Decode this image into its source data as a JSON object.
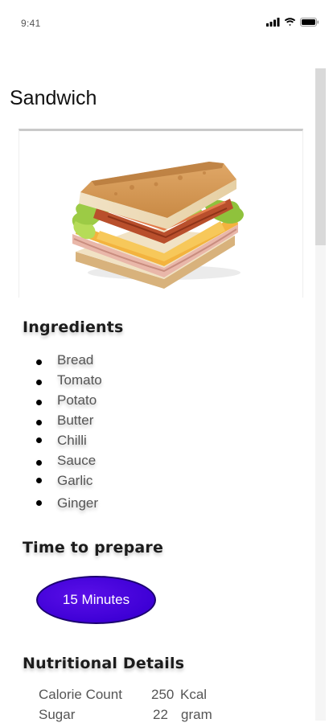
{
  "status_bar": {
    "time": "9:41"
  },
  "header": {
    "title": "Sandwich"
  },
  "ingredients": {
    "title": "Ingredients",
    "items": [
      "Bread",
      "Tomato",
      "Potato",
      "Butter",
      "Chilli",
      "Sauce",
      "Garlic",
      "Ginger"
    ]
  },
  "prep_time": {
    "title": "Time to prepare",
    "value": "15 Minutes"
  },
  "nutrition": {
    "title": "Nutritional Details",
    "rows": [
      {
        "label": "Calorie Count",
        "value": "250",
        "unit": "Kcal"
      },
      {
        "label": "Sugar",
        "value": "22",
        "unit": "gram"
      }
    ]
  },
  "colors": {
    "accent": "#3e00d6",
    "accent_border": "#1b0070"
  },
  "icons": [
    "cellular-signal-icon",
    "wifi-icon",
    "battery-icon",
    "sandwich-image"
  ]
}
